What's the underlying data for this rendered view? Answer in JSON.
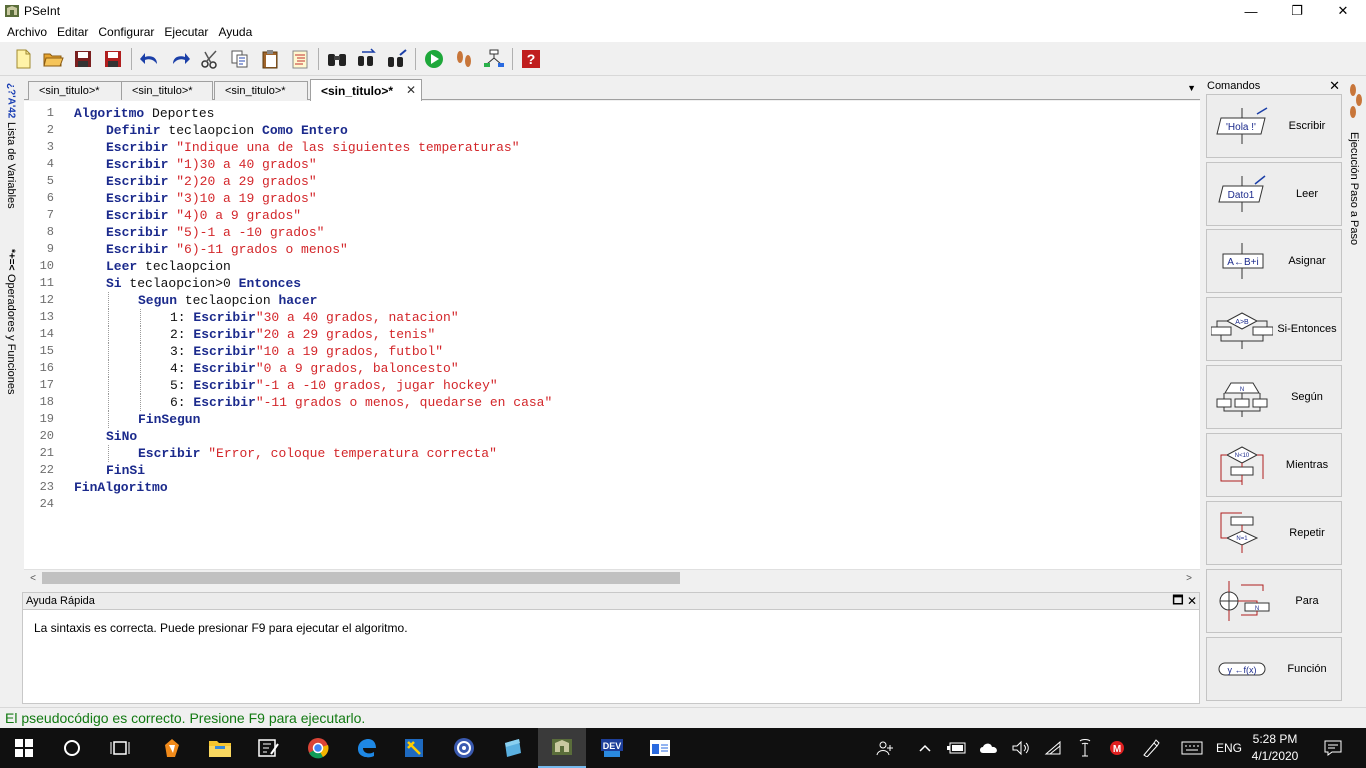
{
  "window": {
    "title": "PSeInt",
    "minimize": "—",
    "maximize": "❐",
    "close": "✕"
  },
  "menu": [
    "Archivo",
    "Editar",
    "Configurar",
    "Ejecutar",
    "Ayuda"
  ],
  "left_panel": {
    "variables_symbols": "¿?'A'42",
    "variables_label": "Lista de Variables",
    "operators_symbols": "*+=<",
    "operators_label": "Operadores y Funciones"
  },
  "tabs": [
    {
      "label": "<sin_titulo>*"
    },
    {
      "label": "<sin_titulo>*"
    },
    {
      "label": "<sin_titulo>*"
    },
    {
      "label": "<sin_titulo>*",
      "active": true
    }
  ],
  "tabs_close": "✕",
  "tabs_menu": "▼",
  "editor": {
    "line_numbers": [
      "1",
      "2",
      "3",
      "4",
      "5",
      "6",
      "7",
      "8",
      "9",
      "10",
      "11",
      "12",
      "13",
      "14",
      "15",
      "16",
      "17",
      "18",
      "19",
      "20",
      "21",
      "22",
      "23",
      "24"
    ],
    "lines": [
      {
        "indent": 0,
        "parts": [
          [
            "kw",
            "Algoritmo"
          ],
          [
            "id",
            " Deportes"
          ]
        ]
      },
      {
        "indent": 1,
        "parts": [
          [
            "kw",
            "Definir"
          ],
          [
            "id",
            " teclaopcion "
          ],
          [
            "kw",
            "Como Entero"
          ]
        ]
      },
      {
        "indent": 1,
        "parts": [
          [
            "kw",
            "Escribir"
          ],
          [
            "id",
            " "
          ],
          [
            "str",
            "\"Indique una de las siguientes temperaturas\""
          ]
        ]
      },
      {
        "indent": 1,
        "parts": [
          [
            "kw",
            "Escribir"
          ],
          [
            "id",
            " "
          ],
          [
            "str",
            "\"1)30 a 40 grados\""
          ]
        ]
      },
      {
        "indent": 1,
        "parts": [
          [
            "kw",
            "Escribir"
          ],
          [
            "id",
            " "
          ],
          [
            "str",
            "\"2)20 a 29 grados\""
          ]
        ]
      },
      {
        "indent": 1,
        "parts": [
          [
            "kw",
            "Escribir"
          ],
          [
            "id",
            " "
          ],
          [
            "str",
            "\"3)10 a 19 grados\""
          ]
        ]
      },
      {
        "indent": 1,
        "parts": [
          [
            "kw",
            "Escribir"
          ],
          [
            "id",
            " "
          ],
          [
            "str",
            "\"4)0 a 9 grados\""
          ]
        ]
      },
      {
        "indent": 1,
        "parts": [
          [
            "kw",
            "Escribir"
          ],
          [
            "id",
            " "
          ],
          [
            "str",
            "\"5)-1 a -10 grados\""
          ]
        ]
      },
      {
        "indent": 1,
        "parts": [
          [
            "kw",
            "Escribir"
          ],
          [
            "id",
            " "
          ],
          [
            "str",
            "\"6)-11 grados o menos\""
          ]
        ]
      },
      {
        "indent": 1,
        "parts": [
          [
            "kw",
            "Leer"
          ],
          [
            "id",
            " teclaopcion"
          ]
        ]
      },
      {
        "indent": 1,
        "parts": [
          [
            "kw",
            "Si"
          ],
          [
            "id",
            " teclaopcion>"
          ],
          [
            "id",
            "0"
          ],
          [
            "id",
            " "
          ],
          [
            "kw",
            "Entonces"
          ]
        ]
      },
      {
        "indent": 2,
        "guides": [
          1
        ],
        "parts": [
          [
            "kw",
            "Segun"
          ],
          [
            "id",
            " teclaopcion "
          ],
          [
            "kw",
            "hacer"
          ]
        ]
      },
      {
        "indent": 3,
        "guides": [
          1,
          2
        ],
        "parts": [
          [
            "id",
            "1: "
          ],
          [
            "kw",
            "Escribir"
          ],
          [
            "str",
            "\"30 a 40 grados, natacion\""
          ]
        ]
      },
      {
        "indent": 3,
        "guides": [
          1,
          2
        ],
        "parts": [
          [
            "id",
            "2: "
          ],
          [
            "kw",
            "Escribir"
          ],
          [
            "str",
            "\"20 a 29 grados, tenis\""
          ]
        ]
      },
      {
        "indent": 3,
        "guides": [
          1,
          2
        ],
        "parts": [
          [
            "id",
            "3: "
          ],
          [
            "kw",
            "Escribir"
          ],
          [
            "str",
            "\"10 a 19 grados, futbol\""
          ]
        ]
      },
      {
        "indent": 3,
        "guides": [
          1,
          2
        ],
        "parts": [
          [
            "id",
            "4: "
          ],
          [
            "kw",
            "Escribir"
          ],
          [
            "str",
            "\"0 a 9 grados, baloncesto\""
          ]
        ]
      },
      {
        "indent": 3,
        "guides": [
          1,
          2
        ],
        "parts": [
          [
            "id",
            "5: "
          ],
          [
            "kw",
            "Escribir"
          ],
          [
            "str",
            "\"-1 a -10 grados, jugar hockey\""
          ]
        ]
      },
      {
        "indent": 3,
        "guides": [
          1,
          2
        ],
        "parts": [
          [
            "id",
            "6: "
          ],
          [
            "kw",
            "Escribir"
          ],
          [
            "str",
            "\"-11 grados o menos, quedarse en casa\""
          ]
        ]
      },
      {
        "indent": 2,
        "guides": [
          1
        ],
        "parts": [
          [
            "kw",
            "FinSegun"
          ]
        ]
      },
      {
        "indent": 1,
        "parts": [
          [
            "kw",
            "SiNo"
          ]
        ]
      },
      {
        "indent": 2,
        "guides": [
          1
        ],
        "parts": [
          [
            "kw",
            "Escribir"
          ],
          [
            "id",
            " "
          ],
          [
            "str",
            "\"Error, coloque temperatura correcta\""
          ]
        ]
      },
      {
        "indent": 1,
        "parts": [
          [
            "kw",
            "FinSi"
          ]
        ]
      },
      {
        "indent": 0,
        "parts": [
          [
            "kw",
            "FinAlgoritmo"
          ]
        ]
      },
      {
        "indent": 0,
        "parts": []
      }
    ]
  },
  "hscroll": {
    "left": "<",
    "right": ">"
  },
  "help": {
    "title": "Ayuda Rápida",
    "restore": "🗖",
    "close": "✕",
    "message": "La sintaxis es correcta. Puede presionar F9 para ejecutar el algoritmo."
  },
  "commands": {
    "title": "Comandos",
    "close": "✕",
    "items": [
      {
        "label": "Escribir",
        "icon": "escribir-icon",
        "icon_text": "'Hola !'"
      },
      {
        "label": "Leer",
        "icon": "leer-icon",
        "icon_text": "Dato1"
      },
      {
        "label": "Asignar",
        "icon": "asignar-icon",
        "icon_text": "A←B+i"
      },
      {
        "label": "Si-Entonces",
        "icon": "si-entonces-icon",
        "icon_text": "A>B"
      },
      {
        "label": "Según",
        "icon": "segun-icon",
        "icon_text": "N"
      },
      {
        "label": "Mientras",
        "icon": "mientras-icon",
        "icon_text": "N<10"
      },
      {
        "label": "Repetir",
        "icon": "repetir-icon",
        "icon_text": "N=1"
      },
      {
        "label": "Para",
        "icon": "para-icon",
        "icon_text": "N"
      },
      {
        "label": "Función",
        "icon": "funcion-icon",
        "icon_text": "y ←f(x)"
      }
    ]
  },
  "right_vtab": {
    "label": "Ejecución Paso a Paso"
  },
  "status": {
    "message": "El pseudocódigo es correcto. Presione F9 para ejecutarlo.",
    "color": "#127a12"
  },
  "taskbar": {
    "time": "5:28 PM",
    "date": "4/1/2020",
    "language": "ENG"
  }
}
